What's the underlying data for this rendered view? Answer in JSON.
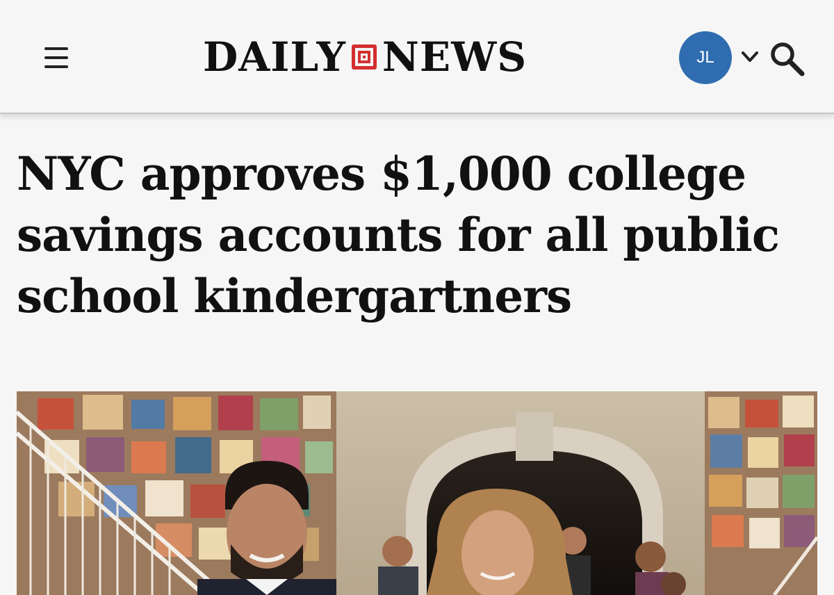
{
  "header": {
    "logo_left": "DAILY",
    "logo_right": "NEWS",
    "user_initials": "JL",
    "avatar_color": "#2f6db0",
    "icons": [
      "menu-icon",
      "chevron-down-icon",
      "search-icon"
    ]
  },
  "article": {
    "headline": "NYC approves $1,000 college savings accounts for all public school kindergartners"
  },
  "colors": {
    "background": "#f6f6f6",
    "text": "#111111",
    "logo_accent": "#d32f2f"
  }
}
